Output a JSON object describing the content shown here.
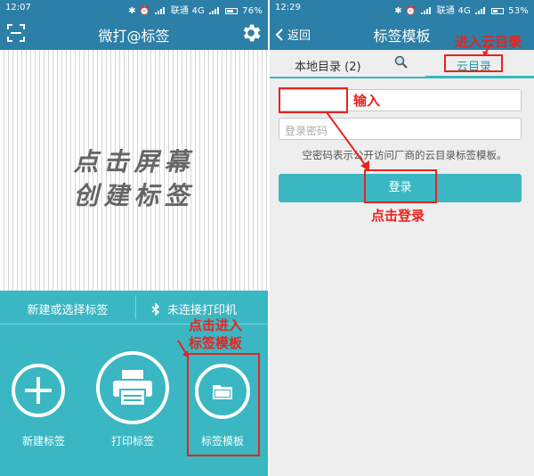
{
  "left": {
    "status": {
      "time": "12:07",
      "carrier": "联通",
      "network": "4G",
      "battery": "76%",
      "battery_level": 0.76
    },
    "title": "微打@标签",
    "canvas_hint_line1": "点击屏幕",
    "canvas_hint_line2": "创建标签",
    "new_select_label": "新建或选择标签",
    "printer_status": "未连接打印机",
    "buttons": {
      "new_label": "新建标签",
      "print_label": "打印标签",
      "template_label": "标签模板"
    },
    "annotation": {
      "line1": "点击进入",
      "line2": "标签模板"
    }
  },
  "right": {
    "status": {
      "time": "12:29",
      "carrier": "联通",
      "network": "4G",
      "battery": "53%",
      "battery_level": 0.53
    },
    "back_label": "返回",
    "title": "标签模板",
    "tabs": {
      "local": "本地目录 (2)",
      "cloud": "云目录"
    },
    "password_placeholder": "登录密码",
    "note": "空密码表示公开访问厂商的云目录标签模板。",
    "login_button": "登录",
    "annotations": {
      "enter_cloud": "进入云目录",
      "input": "输入",
      "tap_login": "点击登录"
    }
  },
  "colors": {
    "header": "#2c7fa6",
    "accent": "#3ab7c3",
    "annotation": "#e8231f"
  }
}
